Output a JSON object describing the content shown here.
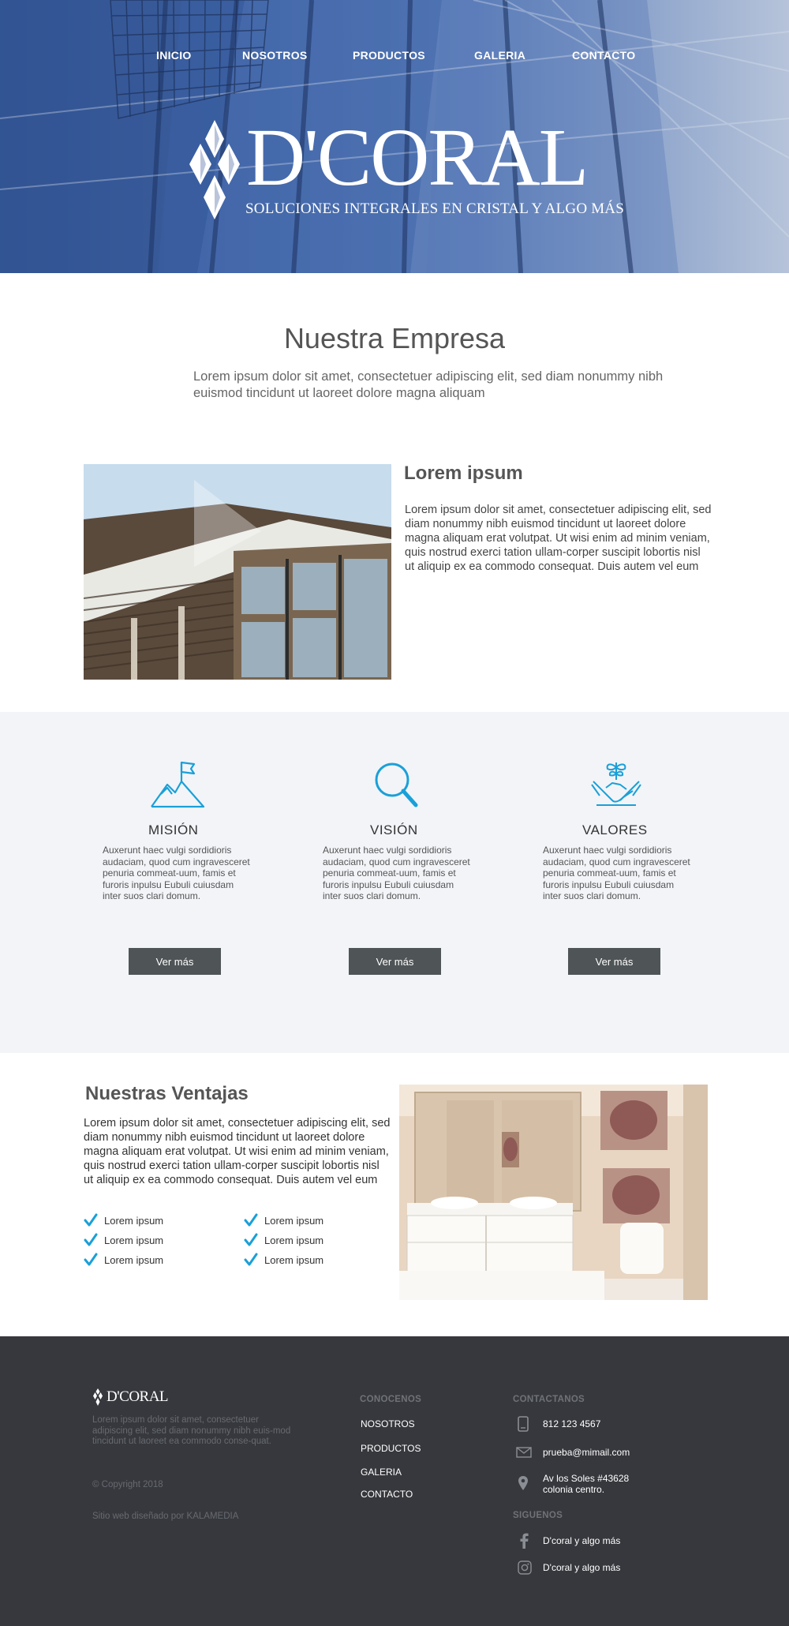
{
  "nav": {
    "items": [
      "INICIO",
      "NOSOTROS",
      "PRODUCTOS",
      "GALERIA",
      "CONTACTO"
    ]
  },
  "brand": {
    "name": "D'CORAL",
    "tagline": "SOLUCIONES INTEGRALES EN CRISTAL Y ALGO MÁS"
  },
  "empresa": {
    "title": "Nuestra Empresa",
    "text": "Lorem ipsum dolor sit amet, consectetuer adipiscing elit, sed diam nonummy nibh euismod tincidunt ut laoreet dolore magna aliquam"
  },
  "about": {
    "title": "Lorem ipsum",
    "text": "Lorem ipsum dolor sit amet, consectetuer adipiscing elit, sed diam nonummy nibh euismod tincidunt ut laoreet dolore magna aliquam erat volutpat. Ut wisi enim ad minim veniam, quis nostrud exerci tation ullam-corper suscipit lobortis nisl ut aliquip ex ea commodo consequat. Duis autem vel eum"
  },
  "features": [
    {
      "icon": "mountain-flag-icon",
      "title": "MISIÓN",
      "text": "Auxerunt haec vulgi sordidioris audaciam, quod cum ingravesceret penuria commeat-uum, famis et furoris inpulsu Eubuli cuiusdam inter suos clari domum.",
      "button": "Ver más"
    },
    {
      "icon": "magnifier-icon",
      "title": "VISIÓN",
      "text": "Auxerunt haec vulgi sordidioris audaciam, quod cum ingravesceret penuria commeat-uum, famis et furoris inpulsu Eubuli cuiusdam inter suos clari domum.",
      "button": "Ver más"
    },
    {
      "icon": "handshake-plant-icon",
      "title": "VALORES",
      "text": "Auxerunt haec vulgi sordidioris audaciam, quod cum ingravesceret penuria commeat-uum, famis et furoris inpulsu Eubuli cuiusdam inter suos clari domum.",
      "button": "Ver más"
    }
  ],
  "ventajas": {
    "title": "Nuestras Ventajas",
    "text": "Lorem ipsum dolor sit amet, consectetuer adipiscing elit, sed diam nonummy nibh euismod tincidunt ut laoreet dolore magna aliquam erat volutpat. Ut wisi enim ad minim veniam, quis nostrud exerci tation ullam-corper suscipit lobortis nisl ut aliquip ex ea commodo consequat. Duis autem vel eum",
    "checks": [
      "Lorem ipsum",
      "Lorem ipsum",
      "Lorem ipsum",
      "Lorem ipsum",
      "Lorem ipsum",
      "Lorem ipsum"
    ]
  },
  "footer": {
    "logo": "D'CORAL",
    "desc": "Lorem ipsum dolor sit amet, consectetuer adipiscing elit, sed diam nonummy nibh euis-mod tincidunt ut laoreet ea commodo conse-quat.",
    "copyright": "© Copyright 2018",
    "credit": "Sitio web diseñado por KALAMEDIA",
    "conocenos_title": "CONOCENOS",
    "links": [
      "NOSOTROS",
      "PRODUCTOS",
      "GALERIA",
      "CONTACTO"
    ],
    "contact_title": "CONTACTANOS",
    "phone": "812 123 4567",
    "email": "prueba@mimail.com",
    "address_line1": "Av los Soles #43628",
    "address_line2": "colonia centro.",
    "follow_title": "SIGUENOS",
    "facebook": "D'coral  y algo más",
    "instagram": "D'coral y algo más"
  },
  "colors": {
    "accent": "#1aa0d8",
    "button": "#4f5456",
    "footer_bg": "#37383d",
    "features_bg": "#f2f4f8"
  }
}
